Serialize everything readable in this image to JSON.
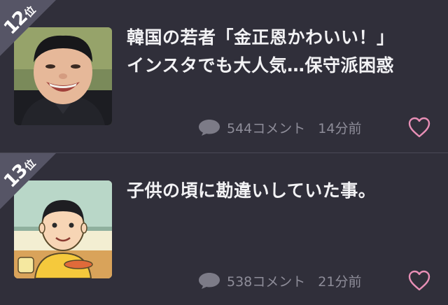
{
  "colors": {
    "background": "#302f3a",
    "ribbon": "#565566",
    "title_text": "#f2f2f4",
    "meta_text": "#8e8d99",
    "heart": "#e88fb6"
  },
  "items": [
    {
      "rank": "12",
      "rank_suffix": "位",
      "title": "韓国の若者「金正恩かわいい！」　インスタでも大人気…保守派困惑",
      "comment_count": "544コメント",
      "time_ago": "14分前",
      "thumbnail": "smiling-man-photo",
      "comment_icon": "speech-bubble-icon",
      "favorite_icon": "heart-outline-icon"
    },
    {
      "rank": "13",
      "rank_suffix": "位",
      "title": "子供の頃に勘違いしていた事。",
      "comment_count": "538コメント",
      "time_ago": "21分前",
      "thumbnail": "cartoon-boy-illustration",
      "comment_icon": "speech-bubble-icon",
      "favorite_icon": "heart-outline-icon"
    }
  ]
}
